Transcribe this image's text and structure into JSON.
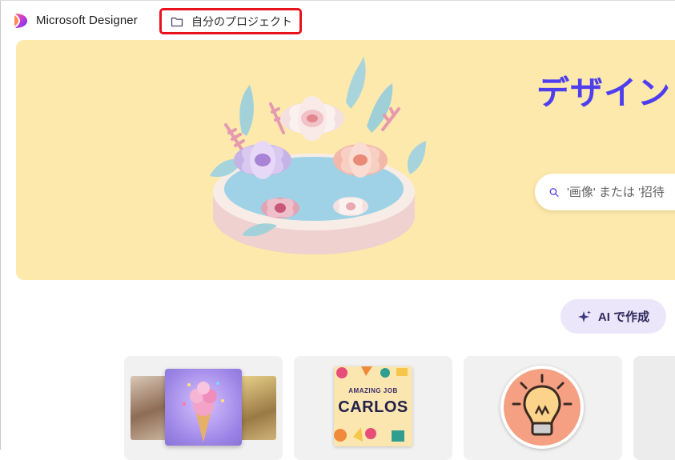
{
  "header": {
    "app_title": "Microsoft Designer",
    "projects_button": "自分のプロジェクト",
    "logo_icon": "designer-logo-icon",
    "folder_icon": "folder-icon"
  },
  "hero": {
    "title": "デザインし",
    "search": {
      "placeholder": "'画像' または '招待"
    }
  },
  "ai_button": {
    "label": "AI で作成",
    "icon": "sparkle-icon"
  },
  "cards": [
    {
      "id": "image-generation",
      "thumbnail": "ice-cream-cone"
    },
    {
      "id": "poster",
      "small_text": "AMAZING JOB",
      "big_text": "CARLOS"
    },
    {
      "id": "sticker",
      "thumbnail": "lightbulb"
    },
    {
      "id": "partial",
      "thumbnail": ""
    }
  ],
  "colors": {
    "accent": "#4d3ef0",
    "hero_bg": "#fde9ac",
    "highlight_border": "#e8111c",
    "ai_button_bg": "#ece6fb"
  }
}
